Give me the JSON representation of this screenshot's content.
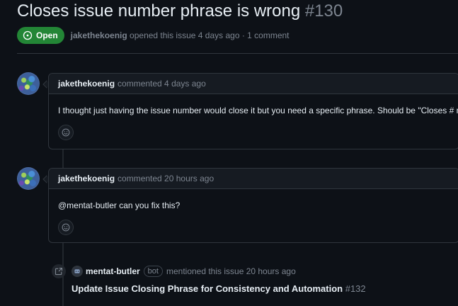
{
  "issue": {
    "title": "Closes issue number phrase is wrong",
    "number": "#130",
    "state": "Open",
    "author": "jakethekoenig",
    "opened_text": "opened this issue 4 days ago · 1 comment"
  },
  "comments": [
    {
      "author": "jakethekoenig",
      "action": "commented 4 days ago",
      "body": "I thought just having the issue number would close it but you need a specific phrase. Should be \"Closes # n\""
    },
    {
      "author": "jakethekoenig",
      "action": "commented 20 hours ago",
      "body": "@mentat-butler can you fix this?"
    }
  ],
  "mention": {
    "author": "mentat-butler",
    "badge": "bot",
    "action": "mentioned this issue 20 hours ago",
    "pr_title": "Update Issue Closing Phrase for Consistency and Automation",
    "pr_number": "#132"
  },
  "colors": {
    "background": "#0d1117",
    "open_badge": "#238636",
    "border": "#30363d",
    "muted_text": "#7d8590"
  },
  "icons": [
    "issue-open-icon",
    "smiley-icon",
    "cross-reference-icon"
  ]
}
